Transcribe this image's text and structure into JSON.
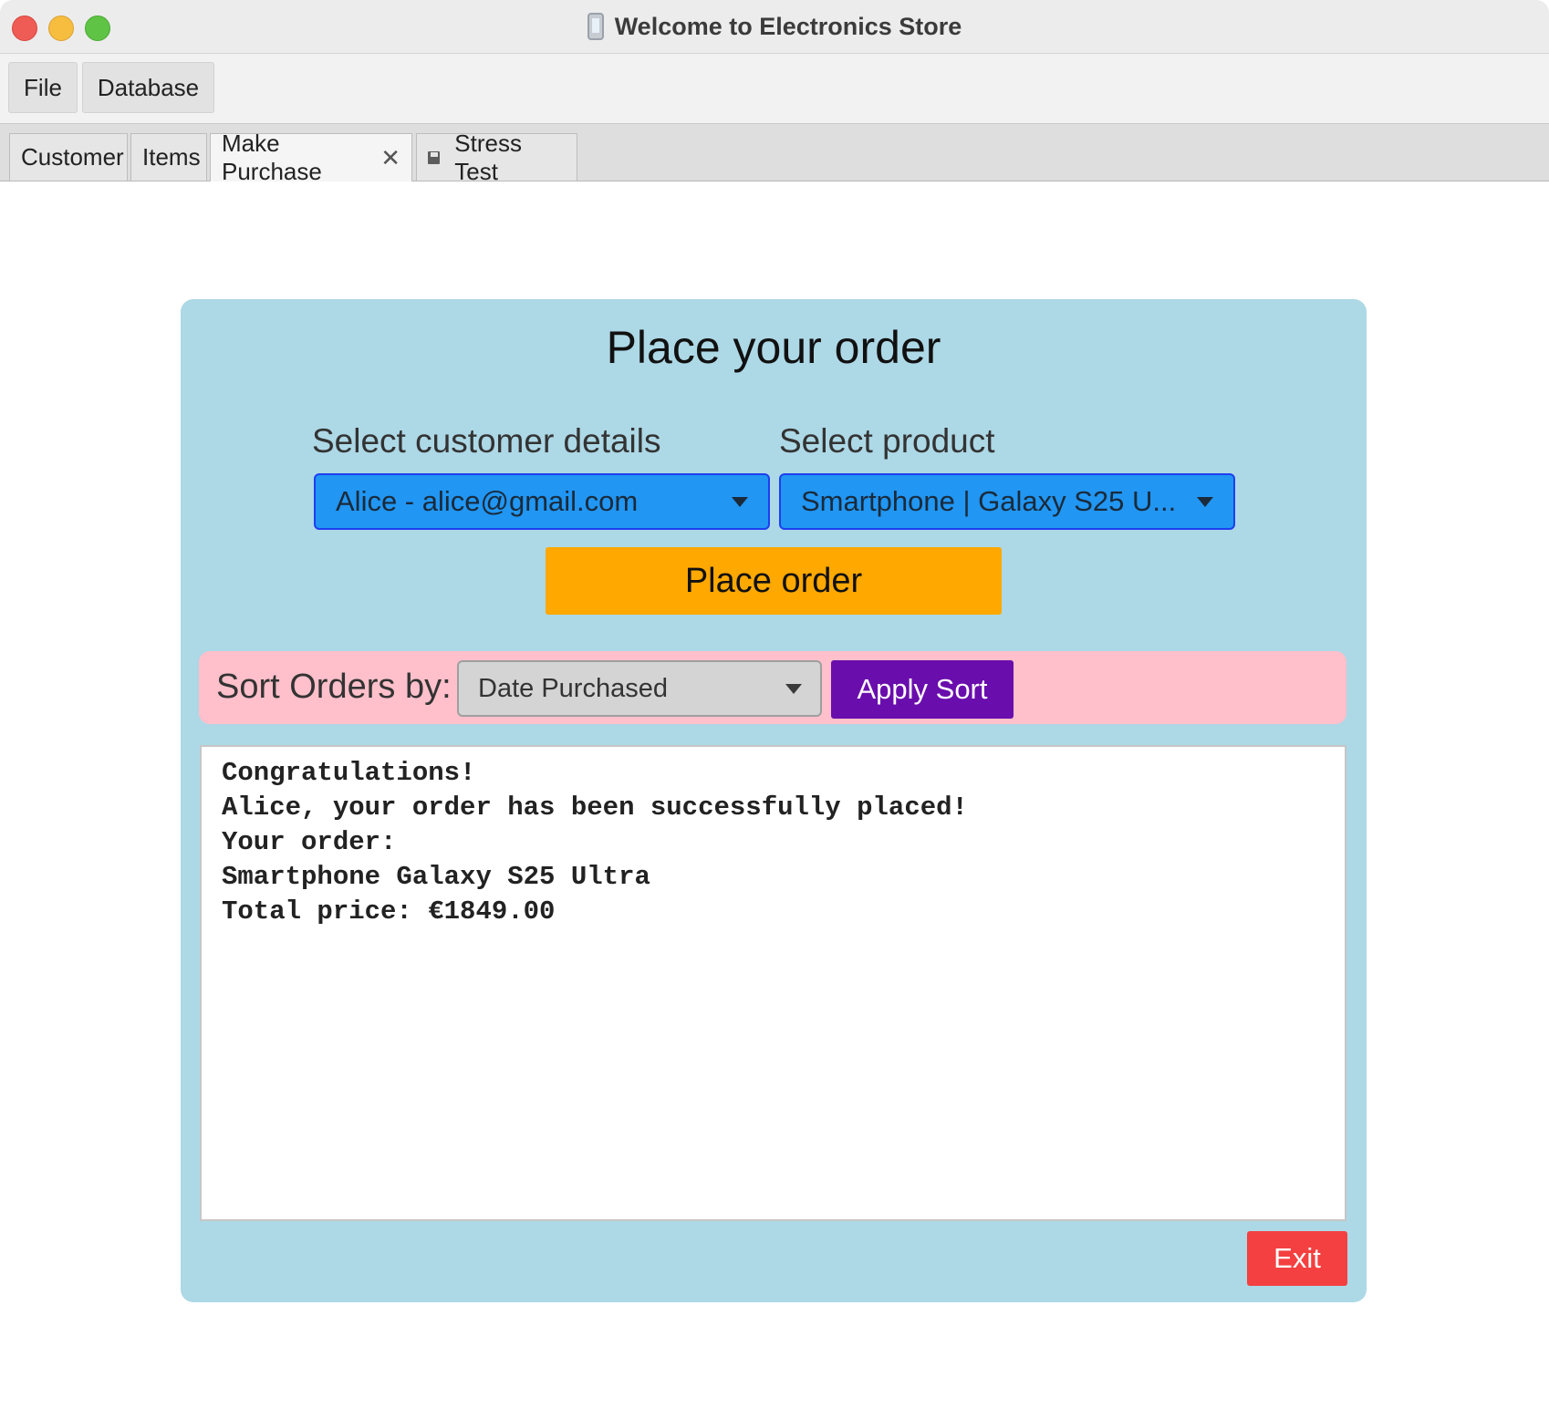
{
  "window": {
    "title": "Welcome to Electronics Store",
    "icon": "smartphone-icon"
  },
  "menu": {
    "file": "File",
    "database": "Database"
  },
  "tabs": [
    {
      "label": "Customer",
      "active": false
    },
    {
      "label": "Items",
      "active": false
    },
    {
      "label": "Make Purchase",
      "active": true,
      "close_glyph": "✕"
    },
    {
      "label": "Stress Test",
      "active": false,
      "icon": "floppy-disk-icon"
    }
  ],
  "panel": {
    "heading": "Place your order",
    "customer_label": "Select customer details",
    "product_label": "Select product",
    "customer_value": "Alice - alice@gmail.com",
    "product_value": "Smartphone | Galaxy S25 U...",
    "place_order": "Place order",
    "sort_label": "Sort Orders by:",
    "sort_value": "Date Purchased",
    "apply_sort": "Apply Sort",
    "exit": "Exit"
  },
  "output": {
    "lines": [
      "Congratulations!",
      "Alice, your order has been successfully placed!",
      "Your order:",
      "Smartphone Galaxy S25 Ultra",
      "Total price: €1849.00"
    ]
  },
  "colors": {
    "panel_bg": "#add8e6",
    "combo_bg": "#2196f3",
    "place_order_bg": "#ffa800",
    "sort_bar_bg": "#ffc0cb",
    "apply_sort_bg": "#6a0dad",
    "exit_bg": "#f44040"
  }
}
